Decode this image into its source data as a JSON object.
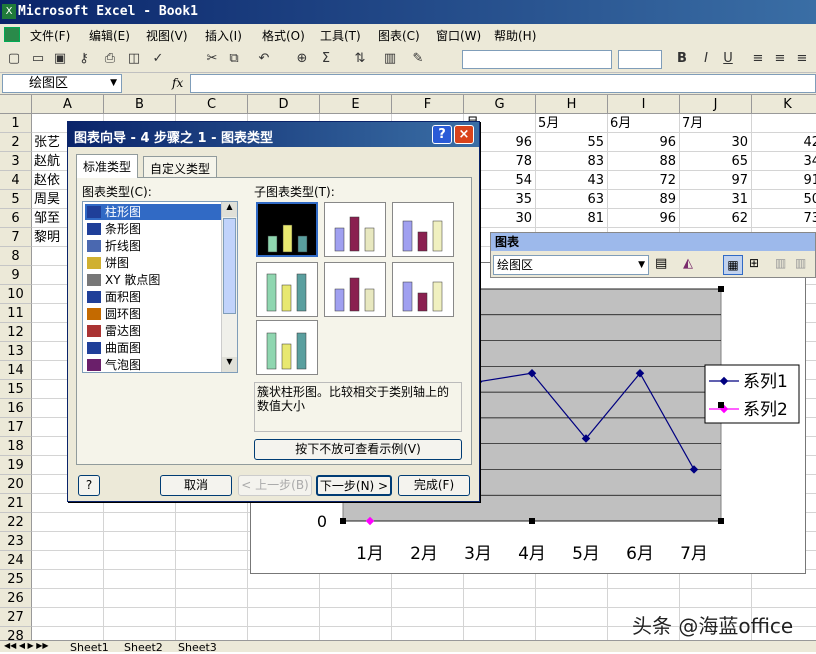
{
  "app": {
    "title": "Microsoft Excel - Book1"
  },
  "menu": [
    "文件(F)",
    "编辑(E)",
    "视图(V)",
    "插入(I)",
    "格式(O)",
    "工具(T)",
    "图表(C)",
    "窗口(W)",
    "帮助(H)"
  ],
  "formula_bar": {
    "name_box": "绘图区",
    "fx": "fx"
  },
  "columns": [
    "A",
    "B",
    "C",
    "D",
    "E",
    "F",
    "G",
    "H",
    "I",
    "J",
    "K"
  ],
  "rows": [
    "1",
    "2",
    "3",
    "4",
    "5",
    "6",
    "7",
    "8",
    "9",
    "10",
    "11",
    "12",
    "13",
    "14",
    "15",
    "16",
    "17",
    "18",
    "19",
    "20",
    "21",
    "22",
    "23",
    "24",
    "25",
    "26",
    "27",
    "28"
  ],
  "sheet": {
    "names": [
      "张艺",
      "赵航",
      "赵依",
      "周昊",
      "邹至",
      "黎明"
    ],
    "header_g": "月",
    "header_h": "5月",
    "header_i": "6月",
    "header_j": "7月",
    "G": [
      "96",
      "78",
      "54",
      "35",
      "30"
    ],
    "H": [
      "55",
      "83",
      "43",
      "63",
      "81"
    ],
    "I": [
      "96",
      "88",
      "72",
      "89",
      "96"
    ],
    "J": [
      "30",
      "65",
      "97",
      "31",
      "62"
    ],
    "K": [
      "42",
      "34",
      "91",
      "50",
      "73"
    ]
  },
  "dialog": {
    "title": "图表向导 - 4 步骤之 1 - 图表类型",
    "help_btn": "?",
    "close_btn": "×",
    "tabs": [
      "标准类型",
      "自定义类型"
    ],
    "type_label": "图表类型(C):",
    "subtype_label": "子图表类型(T):",
    "types": [
      "柱形图",
      "条形图",
      "折线图",
      "饼图",
      "XY 散点图",
      "面积图",
      "圆环图",
      "雷达图",
      "曲面图",
      "气泡图"
    ],
    "description": "簇状柱形图。比较相交于类别轴上的数值大小",
    "preview_button": "按下不放可查看示例(V)",
    "buttons": {
      "cancel": "取消",
      "back": "< 上一步(B)",
      "next": "下一步(N) >",
      "finish": "完成(F)"
    }
  },
  "chart_toolbar": {
    "title": "图表",
    "selector": "绘图区"
  },
  "chart_data": {
    "type": "line",
    "categories": [
      "1月",
      "2月",
      "3月",
      "4月",
      "5月",
      "6月",
      "7月"
    ],
    "series": [
      {
        "name": "系列1",
        "values": [
          null,
          null,
          81,
          86,
          48,
          86,
          30
        ],
        "color": "#000080"
      },
      {
        "name": "系列2",
        "values": [
          0,
          null,
          null,
          null,
          null,
          null,
          null
        ],
        "color": "#ff00ff"
      }
    ],
    "ylim": [
      0,
      135
    ],
    "ytick_visible": "0",
    "grid": true,
    "legend": "right"
  },
  "sheet_tabs": [
    "Sheet1",
    "Sheet2",
    "Sheet3"
  ],
  "watermark": "头条 @海蓝office"
}
